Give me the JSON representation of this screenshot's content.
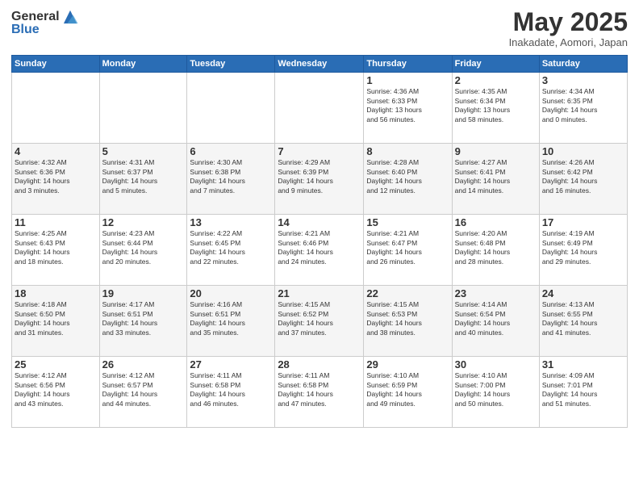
{
  "logo": {
    "general": "General",
    "blue": "Blue"
  },
  "title": "May 2025",
  "subtitle": "Inakadate, Aomori, Japan",
  "days_of_week": [
    "Sunday",
    "Monday",
    "Tuesday",
    "Wednesday",
    "Thursday",
    "Friday",
    "Saturday"
  ],
  "weeks": [
    [
      {
        "day": "",
        "info": ""
      },
      {
        "day": "",
        "info": ""
      },
      {
        "day": "",
        "info": ""
      },
      {
        "day": "",
        "info": ""
      },
      {
        "day": "1",
        "info": "Sunrise: 4:36 AM\nSunset: 6:33 PM\nDaylight: 13 hours\nand 56 minutes."
      },
      {
        "day": "2",
        "info": "Sunrise: 4:35 AM\nSunset: 6:34 PM\nDaylight: 13 hours\nand 58 minutes."
      },
      {
        "day": "3",
        "info": "Sunrise: 4:34 AM\nSunset: 6:35 PM\nDaylight: 14 hours\nand 0 minutes."
      }
    ],
    [
      {
        "day": "4",
        "info": "Sunrise: 4:32 AM\nSunset: 6:36 PM\nDaylight: 14 hours\nand 3 minutes."
      },
      {
        "day": "5",
        "info": "Sunrise: 4:31 AM\nSunset: 6:37 PM\nDaylight: 14 hours\nand 5 minutes."
      },
      {
        "day": "6",
        "info": "Sunrise: 4:30 AM\nSunset: 6:38 PM\nDaylight: 14 hours\nand 7 minutes."
      },
      {
        "day": "7",
        "info": "Sunrise: 4:29 AM\nSunset: 6:39 PM\nDaylight: 14 hours\nand 9 minutes."
      },
      {
        "day": "8",
        "info": "Sunrise: 4:28 AM\nSunset: 6:40 PM\nDaylight: 14 hours\nand 12 minutes."
      },
      {
        "day": "9",
        "info": "Sunrise: 4:27 AM\nSunset: 6:41 PM\nDaylight: 14 hours\nand 14 minutes."
      },
      {
        "day": "10",
        "info": "Sunrise: 4:26 AM\nSunset: 6:42 PM\nDaylight: 14 hours\nand 16 minutes."
      }
    ],
    [
      {
        "day": "11",
        "info": "Sunrise: 4:25 AM\nSunset: 6:43 PM\nDaylight: 14 hours\nand 18 minutes."
      },
      {
        "day": "12",
        "info": "Sunrise: 4:23 AM\nSunset: 6:44 PM\nDaylight: 14 hours\nand 20 minutes."
      },
      {
        "day": "13",
        "info": "Sunrise: 4:22 AM\nSunset: 6:45 PM\nDaylight: 14 hours\nand 22 minutes."
      },
      {
        "day": "14",
        "info": "Sunrise: 4:21 AM\nSunset: 6:46 PM\nDaylight: 14 hours\nand 24 minutes."
      },
      {
        "day": "15",
        "info": "Sunrise: 4:21 AM\nSunset: 6:47 PM\nDaylight: 14 hours\nand 26 minutes."
      },
      {
        "day": "16",
        "info": "Sunrise: 4:20 AM\nSunset: 6:48 PM\nDaylight: 14 hours\nand 28 minutes."
      },
      {
        "day": "17",
        "info": "Sunrise: 4:19 AM\nSunset: 6:49 PM\nDaylight: 14 hours\nand 29 minutes."
      }
    ],
    [
      {
        "day": "18",
        "info": "Sunrise: 4:18 AM\nSunset: 6:50 PM\nDaylight: 14 hours\nand 31 minutes."
      },
      {
        "day": "19",
        "info": "Sunrise: 4:17 AM\nSunset: 6:51 PM\nDaylight: 14 hours\nand 33 minutes."
      },
      {
        "day": "20",
        "info": "Sunrise: 4:16 AM\nSunset: 6:51 PM\nDaylight: 14 hours\nand 35 minutes."
      },
      {
        "day": "21",
        "info": "Sunrise: 4:15 AM\nSunset: 6:52 PM\nDaylight: 14 hours\nand 37 minutes."
      },
      {
        "day": "22",
        "info": "Sunrise: 4:15 AM\nSunset: 6:53 PM\nDaylight: 14 hours\nand 38 minutes."
      },
      {
        "day": "23",
        "info": "Sunrise: 4:14 AM\nSunset: 6:54 PM\nDaylight: 14 hours\nand 40 minutes."
      },
      {
        "day": "24",
        "info": "Sunrise: 4:13 AM\nSunset: 6:55 PM\nDaylight: 14 hours\nand 41 minutes."
      }
    ],
    [
      {
        "day": "25",
        "info": "Sunrise: 4:12 AM\nSunset: 6:56 PM\nDaylight: 14 hours\nand 43 minutes."
      },
      {
        "day": "26",
        "info": "Sunrise: 4:12 AM\nSunset: 6:57 PM\nDaylight: 14 hours\nand 44 minutes."
      },
      {
        "day": "27",
        "info": "Sunrise: 4:11 AM\nSunset: 6:58 PM\nDaylight: 14 hours\nand 46 minutes."
      },
      {
        "day": "28",
        "info": "Sunrise: 4:11 AM\nSunset: 6:58 PM\nDaylight: 14 hours\nand 47 minutes."
      },
      {
        "day": "29",
        "info": "Sunrise: 4:10 AM\nSunset: 6:59 PM\nDaylight: 14 hours\nand 49 minutes."
      },
      {
        "day": "30",
        "info": "Sunrise: 4:10 AM\nSunset: 7:00 PM\nDaylight: 14 hours\nand 50 minutes."
      },
      {
        "day": "31",
        "info": "Sunrise: 4:09 AM\nSunset: 7:01 PM\nDaylight: 14 hours\nand 51 minutes."
      }
    ]
  ]
}
